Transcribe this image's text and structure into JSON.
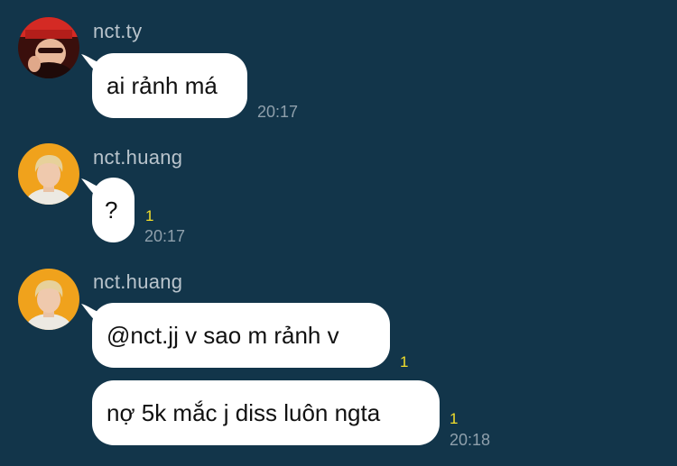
{
  "theme": {
    "background": "#12354a",
    "bubble": "#ffffff",
    "sender_color": "#b9c4cc",
    "time_color": "#8fa0ac",
    "unread_color": "#f2de2b"
  },
  "messages": [
    {
      "sender": "nct.ty",
      "avatar_icon": "user-avatar-red-cap",
      "bubbles": [
        {
          "text": "ai rảnh má",
          "unread": "",
          "time": "20:17"
        }
      ]
    },
    {
      "sender": "nct.huang",
      "avatar_icon": "user-avatar-blond",
      "bubbles": [
        {
          "text": "?",
          "unread": "1",
          "time": "20:17"
        }
      ]
    },
    {
      "sender": "nct.huang",
      "avatar_icon": "user-avatar-blond",
      "bubbles": [
        {
          "text": "@nct.jj v sao m rảnh v",
          "unread": "1",
          "time": ""
        },
        {
          "text": "nợ 5k mắc j diss luôn ngta",
          "unread": "1",
          "time": "20:18"
        }
      ]
    }
  ]
}
